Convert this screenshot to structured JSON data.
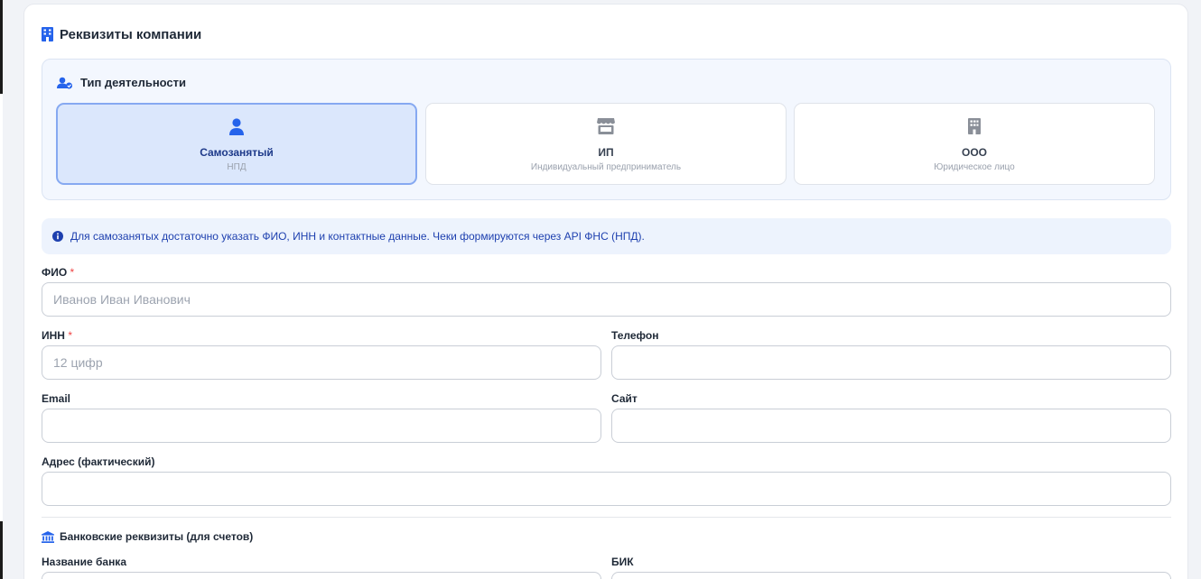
{
  "section": {
    "title": "Реквизиты компании",
    "icon": "building-icon"
  },
  "activity_type": {
    "title": "Тип деятельности",
    "icon": "users-icon",
    "selected": "self_employed",
    "options": [
      {
        "key": "self_employed",
        "label": "Самозанятый",
        "sub": "НПД",
        "icon": "user-icon"
      },
      {
        "key": "ip",
        "label": "ИП",
        "sub": "Индивидуальный предприниматель",
        "icon": "store-icon"
      },
      {
        "key": "ooo",
        "label": "ООО",
        "sub": "Юридическое лицо",
        "icon": "office-building-icon"
      }
    ]
  },
  "info": {
    "text": "Для самозанятых достаточно указать ФИО, ИНН и контактные данные. Чеки формируются через API ФНС (НПД).",
    "icon": "info-circle-icon"
  },
  "fields": {
    "fio": {
      "label": "ФИО",
      "required_mark": "*",
      "placeholder": "Иванов Иван Иванович",
      "value": ""
    },
    "inn": {
      "label": "ИНН",
      "required_mark": "*",
      "placeholder": "12 цифр",
      "value": ""
    },
    "phone": {
      "label": "Телефон",
      "placeholder": "",
      "value": ""
    },
    "email": {
      "label": "Email",
      "placeholder": "",
      "value": ""
    },
    "site": {
      "label": "Сайт",
      "placeholder": "",
      "value": ""
    },
    "address": {
      "label": "Адрес (фактический)",
      "placeholder": "",
      "value": ""
    }
  },
  "bank": {
    "title": "Банковские реквизиты (для счетов)",
    "icon": "bank-icon",
    "bank_name_label": "Название банка",
    "bik_label": "БИК"
  },
  "colors": {
    "accent": "#2563eb",
    "selected_bg": "#dbe7fc",
    "selected_border": "#86a9f1",
    "info_text": "#1e40af",
    "required": "#ef4444"
  }
}
